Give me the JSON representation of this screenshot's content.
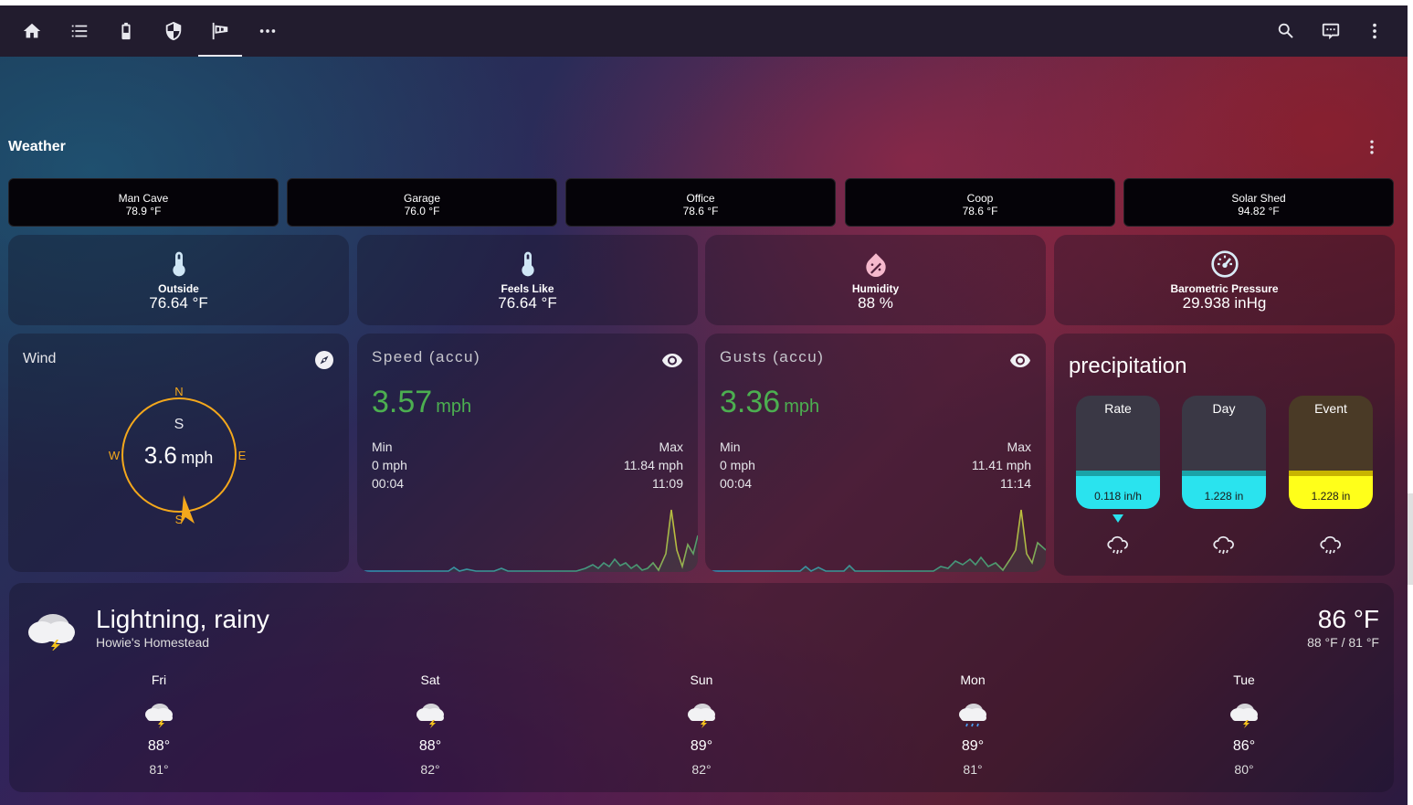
{
  "topbar": {
    "tabs": [
      {
        "icon": "home-icon"
      },
      {
        "icon": "list-icon"
      },
      {
        "icon": "battery-icon"
      },
      {
        "icon": "shield-icon"
      },
      {
        "icon": "windsock-icon",
        "active": true
      },
      {
        "icon": "more-horizontal-icon"
      }
    ],
    "actions": [
      {
        "icon": "search-icon"
      },
      {
        "icon": "chat-icon"
      },
      {
        "icon": "more-vertical-icon"
      }
    ]
  },
  "section": {
    "title": "Weather"
  },
  "rooms": [
    {
      "name": "Man Cave",
      "temp": "78.9 °F"
    },
    {
      "name": "Garage",
      "temp": "76.0 °F"
    },
    {
      "name": "Office",
      "temp": "78.6 °F"
    },
    {
      "name": "Coop",
      "temp": "78.6 °F"
    },
    {
      "name": "Solar Shed",
      "temp": "94.82 °F"
    }
  ],
  "sensors": [
    {
      "name": "Outside",
      "value": "76.64 °F",
      "icon": "thermometer-icon",
      "icon_color": "#cfe6f5"
    },
    {
      "name": "Feels Like",
      "value": "76.64 °F",
      "icon": "thermometer-icon",
      "icon_color": "#cfe6f5"
    },
    {
      "name": "Humidity",
      "value": "88 %",
      "icon": "water-percent-icon",
      "icon_color": "#f5b8cc"
    },
    {
      "name": "Barometric Pressure",
      "value": "29.938 inHg",
      "icon": "gauge-icon",
      "icon_color": "#d9ecf7"
    }
  ],
  "wind": {
    "title": "Wind",
    "direction": "S",
    "speed": "3.6",
    "unit": "mph",
    "compass": {
      "n": "N",
      "e": "E",
      "s": "S",
      "w": "W"
    },
    "bearing_deg": 180
  },
  "speed_card": {
    "title": "Speed (accu)",
    "value": "3.57",
    "unit": "mph",
    "min_label": "Min",
    "min_value": "0 mph",
    "min_time": "00:04",
    "max_label": "Max",
    "max_value": "11.84 mph",
    "max_time": "11:09"
  },
  "gusts_card": {
    "title": "Gusts (accu)",
    "value": "3.36",
    "unit": "mph",
    "min_label": "Min",
    "min_value": "0 mph",
    "min_time": "00:04",
    "max_label": "Max",
    "max_value": "11.41 mph",
    "max_time": "11:14"
  },
  "precipitation": {
    "title": "precipitation",
    "gauges": [
      {
        "label": "Rate",
        "value": "0.118 in/h",
        "level": 0.2,
        "color": "#2ae3ee",
        "line": "#1aa3a8",
        "show_marker": true
      },
      {
        "label": "Day",
        "value": "1.228 in",
        "level": 0.2,
        "color": "#2ae3ee",
        "line": "#1aa3a8",
        "show_marker": false
      },
      {
        "label": "Event",
        "value": "1.228 in",
        "level": 0.2,
        "color": "#ffff1a",
        "line": "#c8b400",
        "show_marker": false
      }
    ]
  },
  "forecast": {
    "condition": "Lightning, rainy",
    "location": "Howie's Homestead",
    "temperature": "86 °F",
    "range": "88 °F / 81 °F",
    "days": [
      {
        "day": "Fri",
        "high": "88°",
        "low": "81°",
        "icon": "lightning-rainy-icon"
      },
      {
        "day": "Sat",
        "high": "88°",
        "low": "82°",
        "icon": "lightning-rainy-icon"
      },
      {
        "day": "Sun",
        "high": "89°",
        "low": "82°",
        "icon": "lightning-rainy-icon"
      },
      {
        "day": "Mon",
        "high": "89°",
        "low": "81°",
        "icon": "rainy-icon"
      },
      {
        "day": "Tue",
        "high": "86°",
        "low": "80°",
        "icon": "lightning-rainy-icon"
      }
    ]
  },
  "colors": {
    "accent_green": "#4caf50",
    "compass_ring": "#f4a81c",
    "graph_line": "#2f8fc0",
    "graph_peak": "#c9c23a"
  }
}
